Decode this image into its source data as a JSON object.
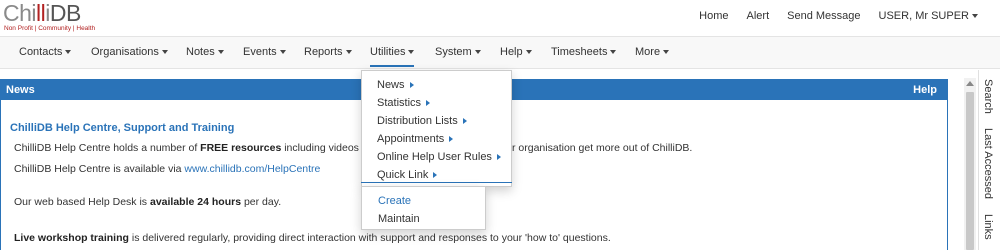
{
  "logo": {
    "name_part1": "Chi",
    "name_part2": "ll",
    "name_part3": "i",
    "name_part4": "DB",
    "tagline": "Non Profit | Community | Health"
  },
  "toplinks": {
    "home": "Home",
    "alert": "Alert",
    "send_message": "Send Message",
    "user": "USER, Mr SUPER"
  },
  "nav": {
    "items": [
      "Contacts",
      "Organisations",
      "Notes",
      "Events",
      "Reports",
      "Utilities",
      "System",
      "Help",
      "Timesheets",
      "More"
    ],
    "active": "Utilities"
  },
  "news": {
    "title": "News",
    "help": "Help",
    "heading": "ChilliDB Help Centre, Support and Training",
    "line1_pre": "ChilliDB Help Centre holds a number of ",
    "line1_bold": "FREE resources",
    "line1_post": " including videos",
    "line1_tail": "r organisation get more out of ChilliDB.",
    "line2_pre": "ChilliDB Help Centre is available via ",
    "line2_link": "www.chillidb.com/HelpCentre",
    "line3_pre": "Our web based Help Desk is ",
    "line3_bold": "available 24 hours",
    "line3_post": " per day.",
    "line4_bold": "Live workshop training",
    "line4_post": " is delivered regularly, providing direct interaction with support and responses to your 'how to' questions."
  },
  "dropdown": {
    "items": [
      "News",
      "Statistics",
      "Distribution Lists",
      "Appointments",
      "Online Help User Rules",
      "Quick Link"
    ],
    "submenu": [
      "Create",
      "Maintain"
    ]
  },
  "sidetabs": [
    "Search",
    "Last Accessed",
    "Links"
  ],
  "colors": {
    "accent": "#2a73b8",
    "brand_red": "#b22222"
  },
  "icons": {
    "caret": "chevron-down-icon",
    "submenu_arrow": "chevron-right-icon"
  }
}
